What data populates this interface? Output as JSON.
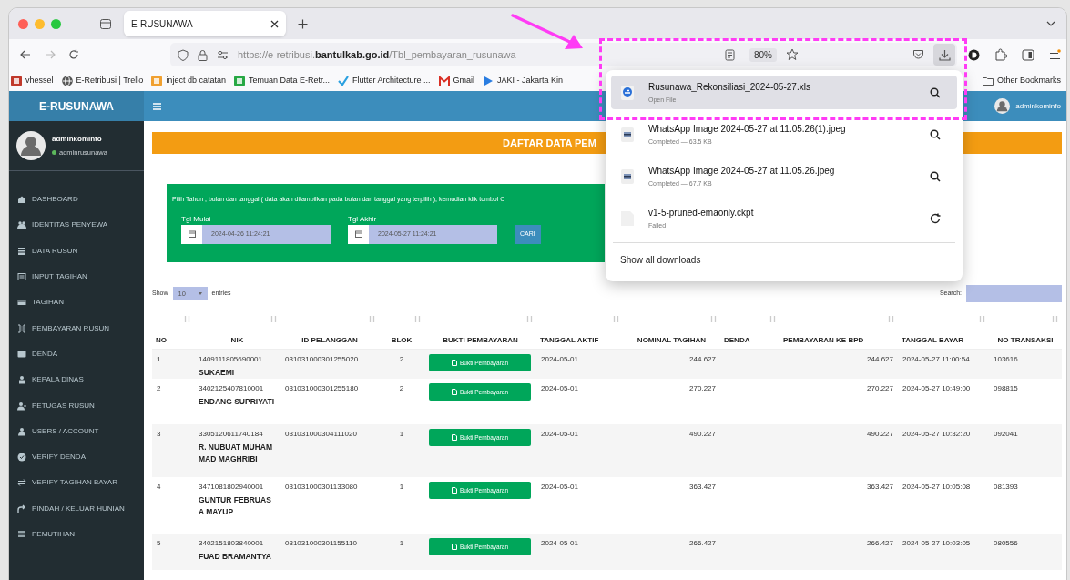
{
  "browser": {
    "tab_title": "E-RUSUNAWA",
    "url": "https://e-retribusi.**bantulkab.go.id**/Tbl_pembayaran_rusunawa",
    "zoom": "80%",
    "bookmarks": [
      {
        "label": "vhessel",
        "kind": "tile",
        "color": "#c0392b"
      },
      {
        "label": "E-Retribusi | Trello",
        "kind": "globe",
        "color": "#555555"
      },
      {
        "label": "inject db catatan",
        "kind": "tile",
        "color": "#f0a030"
      },
      {
        "label": "Temuan Data E-Retr...",
        "kind": "tile",
        "color": "#27a844"
      },
      {
        "label": "Flutter Architecture ...",
        "kind": "check",
        "color": "#2aa0e0"
      },
      {
        "label": "Gmail",
        "kind": "mail",
        "color": "#d93025"
      },
      {
        "label": "JAKI - Jakarta Kin",
        "kind": "play",
        "color": "#2a7de1"
      }
    ],
    "other_bookmarks": "Other Bookmarks"
  },
  "downloads": {
    "items": [
      {
        "name": "Rusunawa_Rekonsiliasi_2024-05-27.xls",
        "status": "Open File",
        "kind": "sheet",
        "failed": false,
        "selected": true
      },
      {
        "name": "WhatsApp Image 2024-05-27 at 11.05.26(1).jpeg",
        "status": "Completed — 63.5 KB",
        "kind": "image",
        "failed": false,
        "selected": false
      },
      {
        "name": "WhatsApp Image 2024-05-27 at 11.05.26.jpeg",
        "status": "Completed — 67.7 KB",
        "kind": "image",
        "failed": false,
        "selected": false
      },
      {
        "name": "v1-5-pruned-emaonly.ckpt",
        "status": "Failed",
        "kind": "blank",
        "failed": true,
        "selected": false
      }
    ],
    "show_all": "Show all downloads"
  },
  "app": {
    "brand": "E-RUSUNAWA",
    "header_user": "adminkominfo",
    "user": {
      "name": "adminkominfo",
      "role": "adminrusunawa"
    }
  },
  "sidebar": {
    "items": [
      "DASHBOARD",
      "IDENTITAS PENYEWA",
      "DATA RUSUN",
      "INPUT TAGIHAN",
      "TAGIHAN",
      "PEMBAYARAN RUSUN",
      "DENDA",
      "KEPALA DINAS",
      "PETUGAS RUSUN",
      "USERS / ACCOUNT",
      "VERIFY DENDA",
      "VERIFY TAGIHAN BAYAR",
      "PINDAH / KELUAR HUNIAN",
      "PEMUTIHAN"
    ]
  },
  "page_title": "DAFTAR DATA PEM",
  "filter": {
    "text": "Pilih Tahun , bulan dan tanggal ( data akan ditampilkan pada bulan dari tanggal yang terpilih ), kemudian klik tombol C",
    "start_label": "Tgl Mulai",
    "start_value": "2024-04-26 11:24:21",
    "end_label": "Tgl Akhir",
    "end_value": "2024-05-27 11:24:21",
    "button": "CARI"
  },
  "table_controls": {
    "show": "Show",
    "entries_value": "10",
    "entries": "entries",
    "search_label": "Search:"
  },
  "table": {
    "columns": [
      "NO",
      "NIK",
      "ID PELANGGAN",
      "BLOK",
      "BUKTI PEMBAYARAN",
      "TANGGAL AKTIF",
      "NOMINAL TAGIHAN",
      "DENDA",
      "PEMBAYARAN KE BPD",
      "TANGGAL BAYAR",
      "NO TRANSAKSI"
    ],
    "rows": [
      {
        "no": "1",
        "nik": "1409111805690001",
        "name": "SUKAEMI",
        "id": "031031000301255020",
        "blok": "2",
        "bukti": "Bukti Pembayaran",
        "tanggal_aktif": "2024-05-01",
        "nominal": "244.627",
        "pembayaran": "244.627",
        "tanggal_bayar": "2024-05-27 11:00:54",
        "no_transaksi": "103616"
      },
      {
        "no": "2",
        "nik": "3402125407810001",
        "name": "ENDANG SUPRIYATI",
        "id": "031031000301255180",
        "blok": "2",
        "bukti": "Bukti Pembayaran",
        "tanggal_aktif": "2024-05-01",
        "nominal": "270.227",
        "pembayaran": "270.227",
        "tanggal_bayar": "2024-05-27 10:49:00",
        "no_transaksi": "098815"
      },
      {
        "no": "3",
        "nik": "3305120611740184",
        "name": "R. NUBUAT MUHAMMAD MAGHRIBI",
        "id": "031031000304111020",
        "blok": "1",
        "bukti": "Bukti Pembayaran",
        "tanggal_aktif": "2024-05-01",
        "nominal": "490.227",
        "pembayaran": "490.227",
        "tanggal_bayar": "2024-05-27 10:32:20",
        "no_transaksi": "092041"
      },
      {
        "no": "4",
        "nik": "3471081802940001",
        "name": "GUNTUR FEBRUASA MAYUP",
        "id": "031031000301133080",
        "blok": "1",
        "bukti": "Bukti Pembayaran",
        "tanggal_aktif": "2024-05-01",
        "nominal": "363.427",
        "pembayaran": "363.427",
        "tanggal_bayar": "2024-05-27 10:05:08",
        "no_transaksi": "081393"
      },
      {
        "no": "5",
        "nik": "3402151803840001",
        "name": "FUAD BRAMANTYA",
        "id": "031031000301155110",
        "blok": "1",
        "bukti": "Bukti Pembayaran",
        "tanggal_aktif": "2024-05-01",
        "nominal": "266.427",
        "pembayaran": "266.427",
        "tanggal_bayar": "2024-05-27 10:03:05",
        "no_transaksi": "080556"
      }
    ]
  }
}
